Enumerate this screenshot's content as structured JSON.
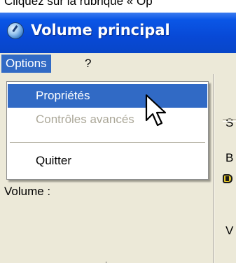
{
  "caption": "Cliquez sur la rubrique « Op",
  "window": {
    "title": "Volume principal",
    "icon": "speaker-volume-icon"
  },
  "menubar": {
    "items": [
      {
        "label": "Options",
        "active": true
      },
      {
        "label": "?",
        "active": false
      }
    ]
  },
  "dropdown": {
    "items": [
      {
        "label": "Propriétés",
        "state": "selected"
      },
      {
        "label": "Contrôles avancés",
        "state": "disabled"
      },
      {
        "label": "Quitter",
        "state": "normal"
      }
    ]
  },
  "panel": {
    "volume_label": "Volume :",
    "left_speaker_icon": "speaker-low-icon",
    "right_speaker_icon": "speaker-high-icon"
  },
  "right_panel": {
    "letters": [
      "S",
      "B",
      "V"
    ]
  },
  "colors": {
    "title_bar": "#0a56e6",
    "selection": "#316ac5",
    "window_bg": "#ece9d8",
    "disabled_text": "#aca899"
  }
}
